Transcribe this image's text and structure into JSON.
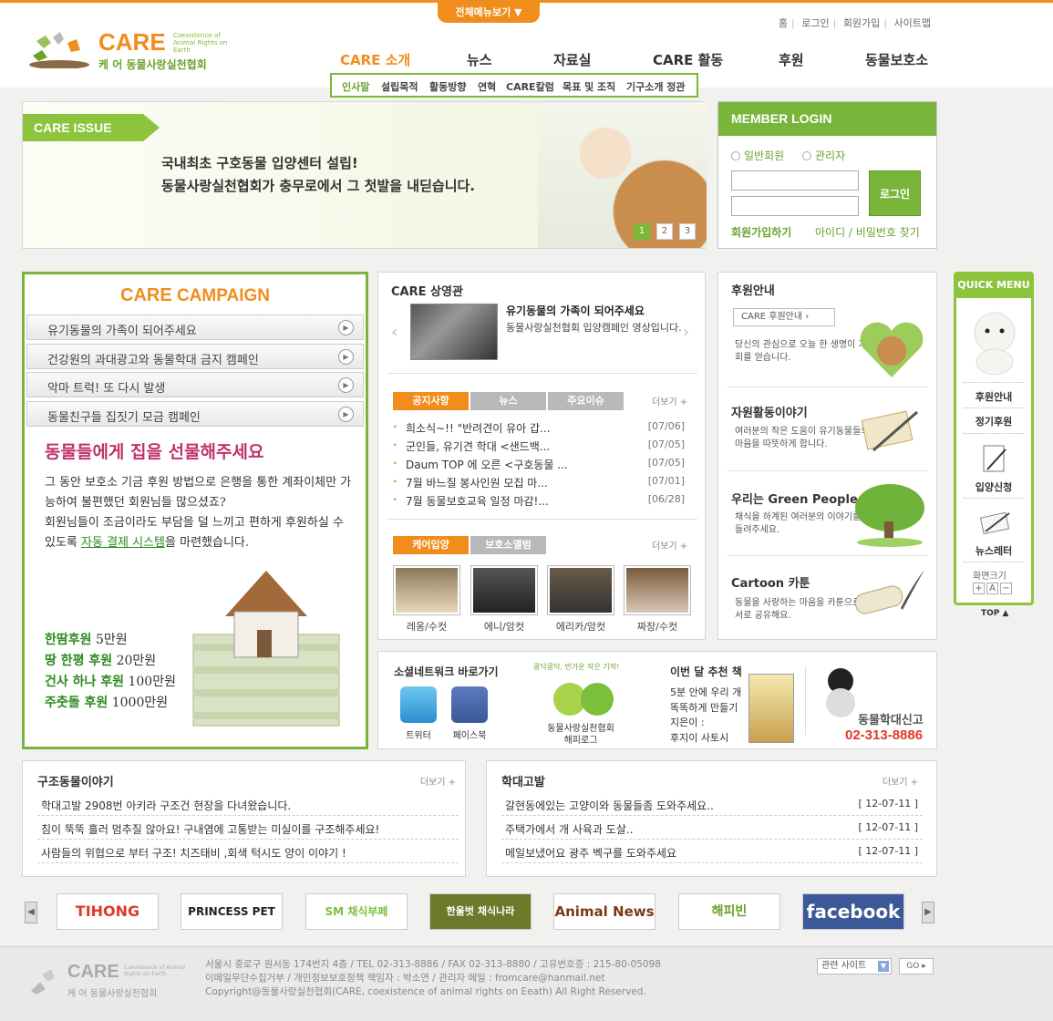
{
  "header": {
    "all_menu": "전체메뉴보기 ▼",
    "util": [
      "홈",
      "로그인",
      "회원가입",
      "사이트맵"
    ],
    "logo": {
      "care": "CARE",
      "sub": "Coexistence of Animal Rights on Earth",
      "kr": "케 어  동물사랑실천협회"
    },
    "gnb": [
      "CARE 소개",
      "뉴스",
      "자료실",
      "CARE 활동",
      "후원",
      "동물보호소"
    ],
    "lnb": [
      "인사말",
      "설립목적",
      "활동방향",
      "연혁",
      "CARE칼럼",
      "목표 및 조직",
      "기구소개 정관"
    ]
  },
  "issue": {
    "tag": "CARE ISSUE",
    "line1": "국내최초 구호동물 입양센터 설립!",
    "line2": "동물사랑실천협회가 충무로에서 그 첫발을 내딛습니다.",
    "pages": [
      "1",
      "2",
      "3"
    ]
  },
  "login": {
    "title": "MEMBER LOGIN",
    "radio1": "일반회원",
    "radio2": "관리자",
    "button": "로그인",
    "join": "회원가입하기",
    "find": "아이디 / 비밀번호 찾기"
  },
  "campaign": {
    "title_a": "CARE",
    "title_b": " CAMPAIGN",
    "items": [
      "유기동물의 가족이 되어주세요",
      "건강원의 과대광고와 동물학대 금지 캠페인",
      "악마 트럭! 또 다시 발생",
      "동물친구들 집짓기 모금 캠페인"
    ],
    "headline": "동물들에게 집을 선물해주세요",
    "body1": "그 동안 보호소 기금 후원 방법으로 은행을 통한 계좌이체만 가능하여 불편했던 회원님들 많으셨죠?",
    "body2": "회원님들이 조금이라도 부담을 덜 느끼고 편하게 후원하실 수 있도록 ",
    "body_link": "자동 결제 시스템",
    "body3": "을 마련했습니다.",
    "money": [
      {
        "k": "한땀후원",
        "v": " 5만원"
      },
      {
        "k": "땅 한평 후원",
        "v": " 20만원"
      },
      {
        "k": "건사 하나 후원",
        "v": " 100만원"
      },
      {
        "k": "주춧돌 후원",
        "v": " 1000만원"
      }
    ]
  },
  "theater": {
    "title": "CARE 상영관",
    "video_title": "유기동물의 가족이 되어주세요",
    "video_desc": "동물사랑실천협회 입양캠페인 영상입니다."
  },
  "notice": {
    "tabs": [
      "공지사항",
      "뉴스",
      "주요이슈"
    ],
    "more": "더보기 +",
    "items": [
      {
        "t": "희소식~!! \"반려견이 유아 갑...",
        "d": "[07/06]"
      },
      {
        "t": "군인들, 유기견 학대 <샌드백...",
        "d": "[07/05]"
      },
      {
        "t": "Daum TOP 에 오른 <구호동물 ...",
        "d": "[07/05]"
      },
      {
        "t": "7월 바느질 봉사인원 모집 마...",
        "d": "[07/01]"
      },
      {
        "t": "7월 동물보호교육 일정 마감!...",
        "d": "[06/28]"
      }
    ]
  },
  "adopt": {
    "tabs": [
      "케어입양",
      "보호소앨범"
    ],
    "more": "더보기 +",
    "pets": [
      "레옹/수컷",
      "에니/암컷",
      "에리카/암컷",
      "짜장/수컷"
    ]
  },
  "support": {
    "title": "후원안내",
    "box": "CARE 후원안내  ›",
    "text": "당신의 관심으로 오늘 한 생명이 기회를 얻습니다.",
    "vol_title": "자원활동이야기",
    "vol_text": "여러분의 작은 도움이 유기동물들의 마음을 따뜻하게 합니다.",
    "green_title": "우리는 Green People",
    "green_text": "채식을 하계된 여러분의 이야기를 들려주세요.",
    "cartoon_title": "Cartoon 카툰",
    "cartoon_text": "동물을 사랑하는 마음을 카툰으로 서로 공유해요."
  },
  "social": {
    "title": "소셜네트워크 바로가기",
    "twitter": "트위터",
    "facebook": "페이스북",
    "happy_top": "콩닥콩닥, 반가운 작은 기적!",
    "happy": "동물사랑실천협회\n해피로그",
    "book_title": "이번 달 추천 책",
    "book_text": "5분 안에 우리 개 똑똑하게 만들기",
    "book_author": "지은이 :\n후지이 사토시",
    "report": "동물학대신고",
    "phone": "02-313-8886"
  },
  "story": {
    "title": "구조동물이야기",
    "more": "더보기 +",
    "items": [
      "학대고발 2908번 아키라 구조건 현장을 다녀왔습니다.",
      "침이 뚝뚝 흘러 멈추질 않아요! 구내염에 고통받는 미실이를 구조해주세요!",
      "사람들의 위협으로 부터 구조! 치즈태비 ,회색 턱시도 양이 이야기 !"
    ]
  },
  "abuse": {
    "title": "학대고발",
    "more": "더보기 +",
    "items": [
      {
        "t": "갈현동에있는 고양이와 동물들좀 도와주세요..",
        "d": "[ 12-07-11 ]"
      },
      {
        "t": "주택가에서 개 사육과 도살..",
        "d": "[ 12-07-11 ]"
      },
      {
        "t": "메일보냈어요 광주 벡구를 도와주세요",
        "d": "[ 12-07-11 ]"
      }
    ]
  },
  "banners": [
    "TIHONG",
    "PRINCESS PET",
    "SM 채식부페",
    "한울벗 채식나라",
    "Animal News",
    "해피빈",
    "facebook"
  ],
  "quick": {
    "title": "QUICK MENU",
    "items": [
      "후원안내",
      "정기후원",
      "입양신청",
      "뉴스레터"
    ],
    "zoom": "화면크기",
    "top": "TOP ▲"
  },
  "footer": {
    "care": "CARE",
    "sub": "Coexistence of Animal Rights on Earth",
    "kr": "케 어  동물사랑실천협회",
    "addr1": "서울시 중로구 원서동 174번지 4층 / TEL 02-313-8886 / FAX 02-313-8880 / 고유번호증 : 215-80-05098",
    "addr2": "이메일무단수집거부 / 개인정보보호정책 책임자 : 박소연 / 관리자 메일 : fromcare@hanmail.net",
    "addr3": "Copyright@동물사랑실천협회(CARE, coexistence of animal rights on Eeath) All Right Reserved.",
    "related": "관련 사이트",
    "go": "GO ▸"
  },
  "colors": {
    "accent": "#f08d1c",
    "green": "#79b53a"
  }
}
